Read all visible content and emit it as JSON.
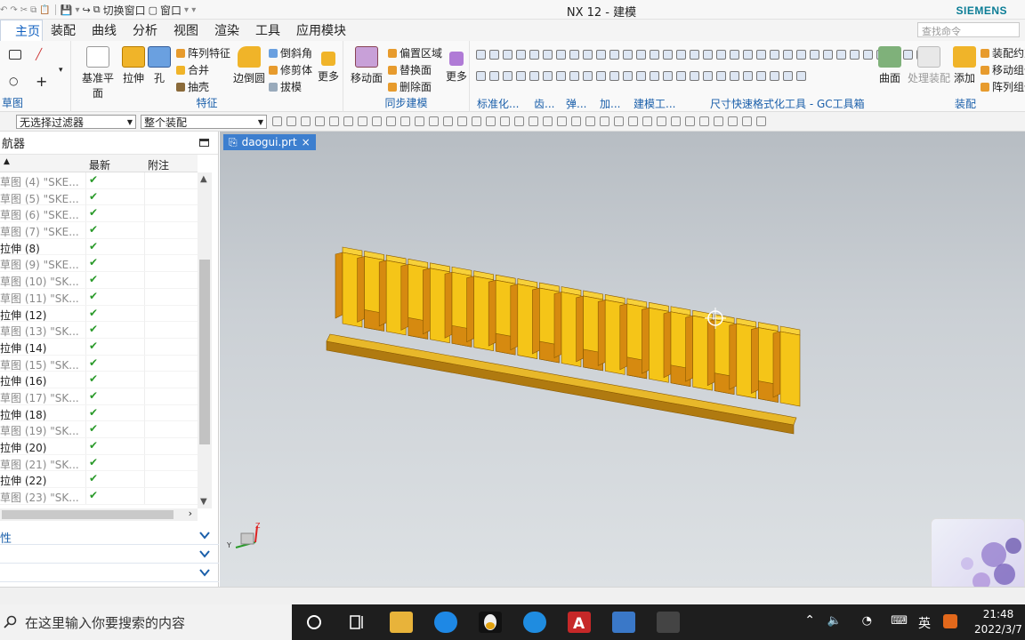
{
  "window": {
    "title": "NX 12 - 建模",
    "brand": "SIEMENS"
  },
  "quick_access": {
    "switch_window": "切换窗口",
    "window_menu": "窗口"
  },
  "menu_tabs": [
    "主页",
    "装配",
    "曲线",
    "分析",
    "视图",
    "渲染",
    "工具",
    "应用模块"
  ],
  "search": {
    "placeholder": "查找命令"
  },
  "ribbon": {
    "sketch_group": "草图",
    "feature": {
      "label": "特征",
      "datum_plane": "基准平面",
      "extrude": "拉伸",
      "hole": "孔",
      "pattern": "阵列特征",
      "unite": "合并",
      "shell": "抽壳",
      "edge_blend": "边倒圆",
      "chamfer": "倒斜角",
      "trim_body": "修剪体",
      "draft": "拔模",
      "more": "更多"
    },
    "sync": {
      "label": "同步建模",
      "move_face": "移动面",
      "offset_region": "偏置区域",
      "replace_face": "替换面",
      "delete_face": "删除面",
      "more": "更多"
    },
    "misc_groups": [
      "标准化...",
      "齿...",
      "弹...",
      "加...",
      "建模工...",
      "尺寸快速格式化工具 - GC工具箱"
    ],
    "surface": "曲面",
    "process_assembly": "处理装配",
    "assembly": {
      "label": "装配",
      "add": "添加",
      "constraints": "装配约束",
      "move_component": "移动组件",
      "pattern_component": "阵列组件"
    }
  },
  "filters": {
    "selection": "无选择过滤器",
    "scope": "整个装配"
  },
  "navigator": {
    "title": "航器",
    "col_latest": "最新",
    "col_note": "附注",
    "rows": [
      {
        "label": "草图 (4) \"SKE...",
        "kind": "sketch"
      },
      {
        "label": "草图 (5) \"SKE...",
        "kind": "sketch"
      },
      {
        "label": "草图 (6) \"SKE...",
        "kind": "sketch"
      },
      {
        "label": "草图 (7) \"SKE...",
        "kind": "sketch"
      },
      {
        "label": "拉伸 (8)",
        "kind": "extrude"
      },
      {
        "label": "草图 (9) \"SKE...",
        "kind": "sketch"
      },
      {
        "label": "草图 (10) \"SK...",
        "kind": "sketch"
      },
      {
        "label": "草图 (11) \"SK...",
        "kind": "sketch"
      },
      {
        "label": "拉伸 (12)",
        "kind": "extrude"
      },
      {
        "label": "草图 (13) \"SK...",
        "kind": "sketch"
      },
      {
        "label": "拉伸 (14)",
        "kind": "extrude"
      },
      {
        "label": "草图 (15) \"SK...",
        "kind": "sketch"
      },
      {
        "label": "拉伸 (16)",
        "kind": "extrude"
      },
      {
        "label": "草图 (17) \"SK...",
        "kind": "sketch"
      },
      {
        "label": "拉伸 (18)",
        "kind": "extrude"
      },
      {
        "label": "草图 (19) \"SK...",
        "kind": "sketch"
      },
      {
        "label": "拉伸 (20)",
        "kind": "extrude"
      },
      {
        "label": "草图 (21) \"SK...",
        "kind": "sketch"
      },
      {
        "label": "拉伸 (22)",
        "kind": "extrude"
      },
      {
        "label": "草图 (23) \"SK...",
        "kind": "sketch"
      }
    ],
    "panels": [
      "性",
      "",
      ""
    ]
  },
  "document": {
    "tab": "daogui.prt",
    "close": "×"
  },
  "colors": {
    "accent": "#1a5faa",
    "part_yellow": "#f5c518",
    "part_orange": "#d68a10",
    "check": "#2a9a2a"
  },
  "taskbar": {
    "search_placeholder": "在这里输入你要搜索的内容",
    "ime": "英",
    "time": "21:48",
    "date": "2022/3/7"
  }
}
